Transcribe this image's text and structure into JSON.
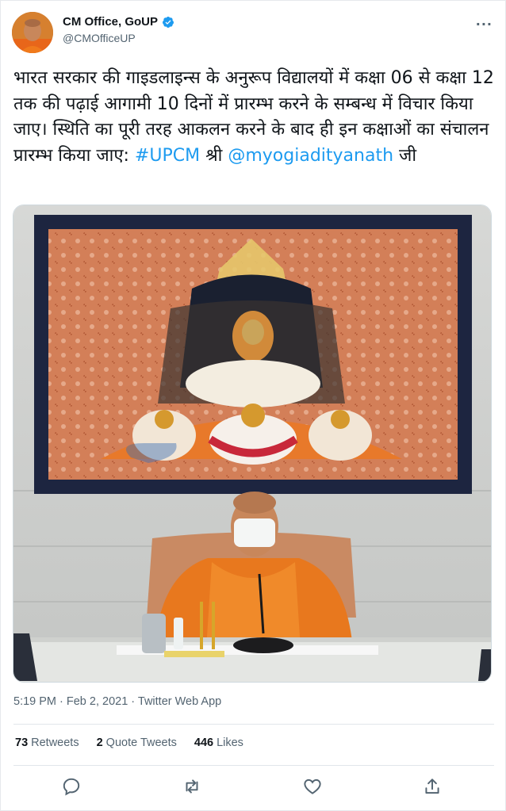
{
  "tweet": {
    "author": {
      "display_name": "CM Office, GoUP",
      "handle": "@CMOfficeUP",
      "verified": true
    },
    "more_icon": "more-horizontal-icon",
    "text_segments": [
      {
        "text": "भारत सरकार की गाइडलाइन्स के अनुरूप विद्यालयों में कक्षा 06 से कक्षा 12 तक की पढ़ाई आगामी 10 दिनों में प्रारम्भ करने के सम्बन्ध में विचार किया जाए। स्थिति का पूरी तरह आकलन करने के बाद ही इन कक्षाओं का संचालन प्रारम्भ किया जाए: ",
        "kind": "text"
      },
      {
        "text": "#UPCM",
        "kind": "hashtag"
      },
      {
        "text": " श्री ",
        "kind": "text"
      },
      {
        "text": "@myogiadityanath",
        "kind": "mention"
      },
      {
        "text": " जी",
        "kind": "text"
      }
    ],
    "timestamp": "5:19 PM · Feb 2, 2021 · Twitter Web App",
    "stats": {
      "retweets_count": "73",
      "retweets_label": "Retweets",
      "quote_tweets_count": "2",
      "quote_tweets_label": "Quote Tweets",
      "likes_count": "446",
      "likes_label": "Likes"
    },
    "actions": [
      "reply-icon",
      "retweet-icon",
      "like-icon",
      "share-icon"
    ]
  },
  "colors": {
    "link": "#1d9bf0",
    "secondary_text": "#536471",
    "verified_badge": "#1d9bf0",
    "robe": "#e87a1e"
  }
}
